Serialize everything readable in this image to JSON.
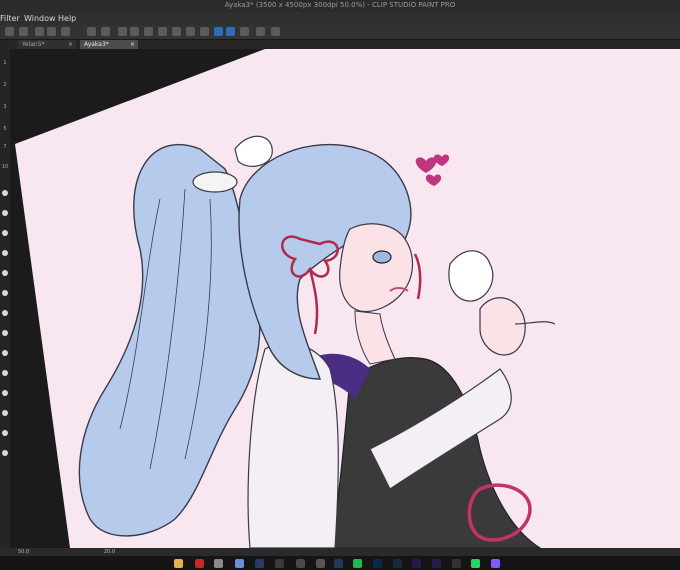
{
  "window": {
    "title": "Ayaka3* (3500 x 4500px 300dpi 50.0%) - CLIP STUDIO PAINT PRO"
  },
  "menu": {
    "filter": "Filter",
    "window": "Window",
    "help": "Help"
  },
  "tabs": [
    {
      "label": "Yelan5*"
    },
    {
      "label": "Ayaka3*"
    }
  ],
  "tab_close_glyph": "×",
  "left_panel": {
    "labels": [
      "1",
      "2",
      "3",
      "5",
      "7",
      "10"
    ]
  },
  "status": {
    "zoom": "50.0",
    "angle": "20.0"
  },
  "colors": {
    "canvas_bg": "#f8e6f1",
    "hair": "#b6cbec",
    "ribbon": "#b02a4a",
    "bodysuit": "#3a3a3a",
    "accent_purple": "#4b2d86",
    "sash": "#c2336c",
    "hearts": "#c0367d",
    "ui_accent": "#2d6fb6"
  },
  "taskbar": {
    "apps": [
      "file-explorer",
      "app-red",
      "browser-a",
      "browser-b",
      "app-dark",
      "app-terminal",
      "steam",
      "spotify",
      "photoshop",
      "lightroom",
      "premiere",
      "aftereffects",
      "media-app",
      "whatsapp",
      "messenger"
    ]
  }
}
